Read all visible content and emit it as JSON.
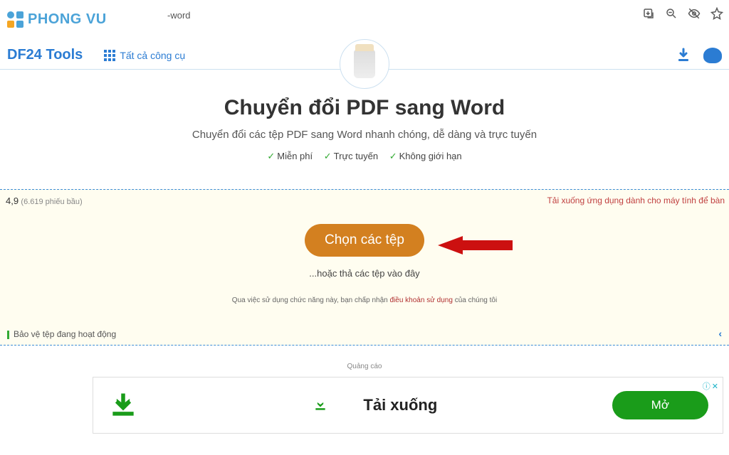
{
  "browser": {
    "url_fragment": "-word"
  },
  "overlay_logo": {
    "text": "PHONG VU"
  },
  "header": {
    "brand": "DF24 Tools",
    "all_tools": "Tất cả công cụ"
  },
  "page": {
    "title": "Chuyển đổi PDF sang Word",
    "subtitle": "Chuyển đổi các tệp PDF sang Word nhanh chóng, dễ dàng và trực tuyến",
    "features": [
      "Miễn phí",
      "Trực tuyến",
      "Không giới hạn"
    ]
  },
  "dropzone": {
    "rating_value": "4,9",
    "rating_count": "(6.619 phiếu bầu)",
    "desktop_link": "Tải xuống ứng dụng dành cho máy tính để bàn",
    "choose_button": "Chọn các tệp",
    "or_drop": "...hoặc thả các tệp vào đây",
    "terms_prefix": "Qua việc sử dụng chức năng này, bạn chấp nhận ",
    "terms_link": "điều khoản sử dụng",
    "terms_suffix": " của chúng tôi",
    "protection": "Bảo vệ tệp đang hoạt động"
  },
  "ad": {
    "label": "Quảng cáo",
    "text": "Tải xuống",
    "open": "Mở"
  }
}
